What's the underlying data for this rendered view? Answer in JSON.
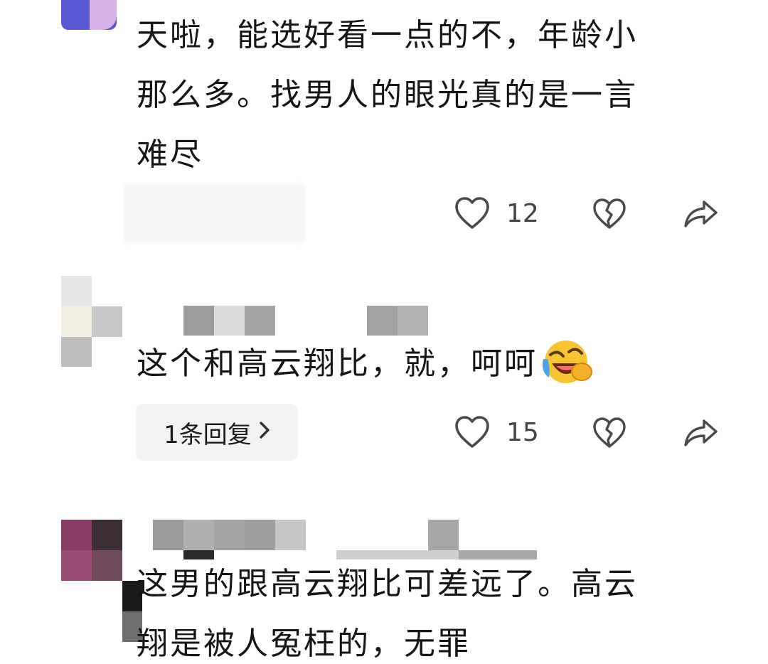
{
  "comments": [
    {
      "text_lines": [
        "天啦，能选好看一点的不，年龄小",
        "那么多。找男人的眼光真的是一言",
        "难尽"
      ],
      "like_count": "12"
    },
    {
      "text": "这个和高云翔比，就，呵呵",
      "emoji": "face-with-tears-of-joy-emoji",
      "reply_label": "1条回复",
      "like_count": "15"
    },
    {
      "text_lines": [
        "这男的跟高云翔比可差远了。高云",
        "翔是被人冤枉的，无罪"
      ]
    }
  ],
  "colors": {
    "text": "#161616",
    "icon": "#4a4a4a",
    "chip_bg": "#f3f3f5",
    "avatar_purple": "#5b58d6"
  }
}
